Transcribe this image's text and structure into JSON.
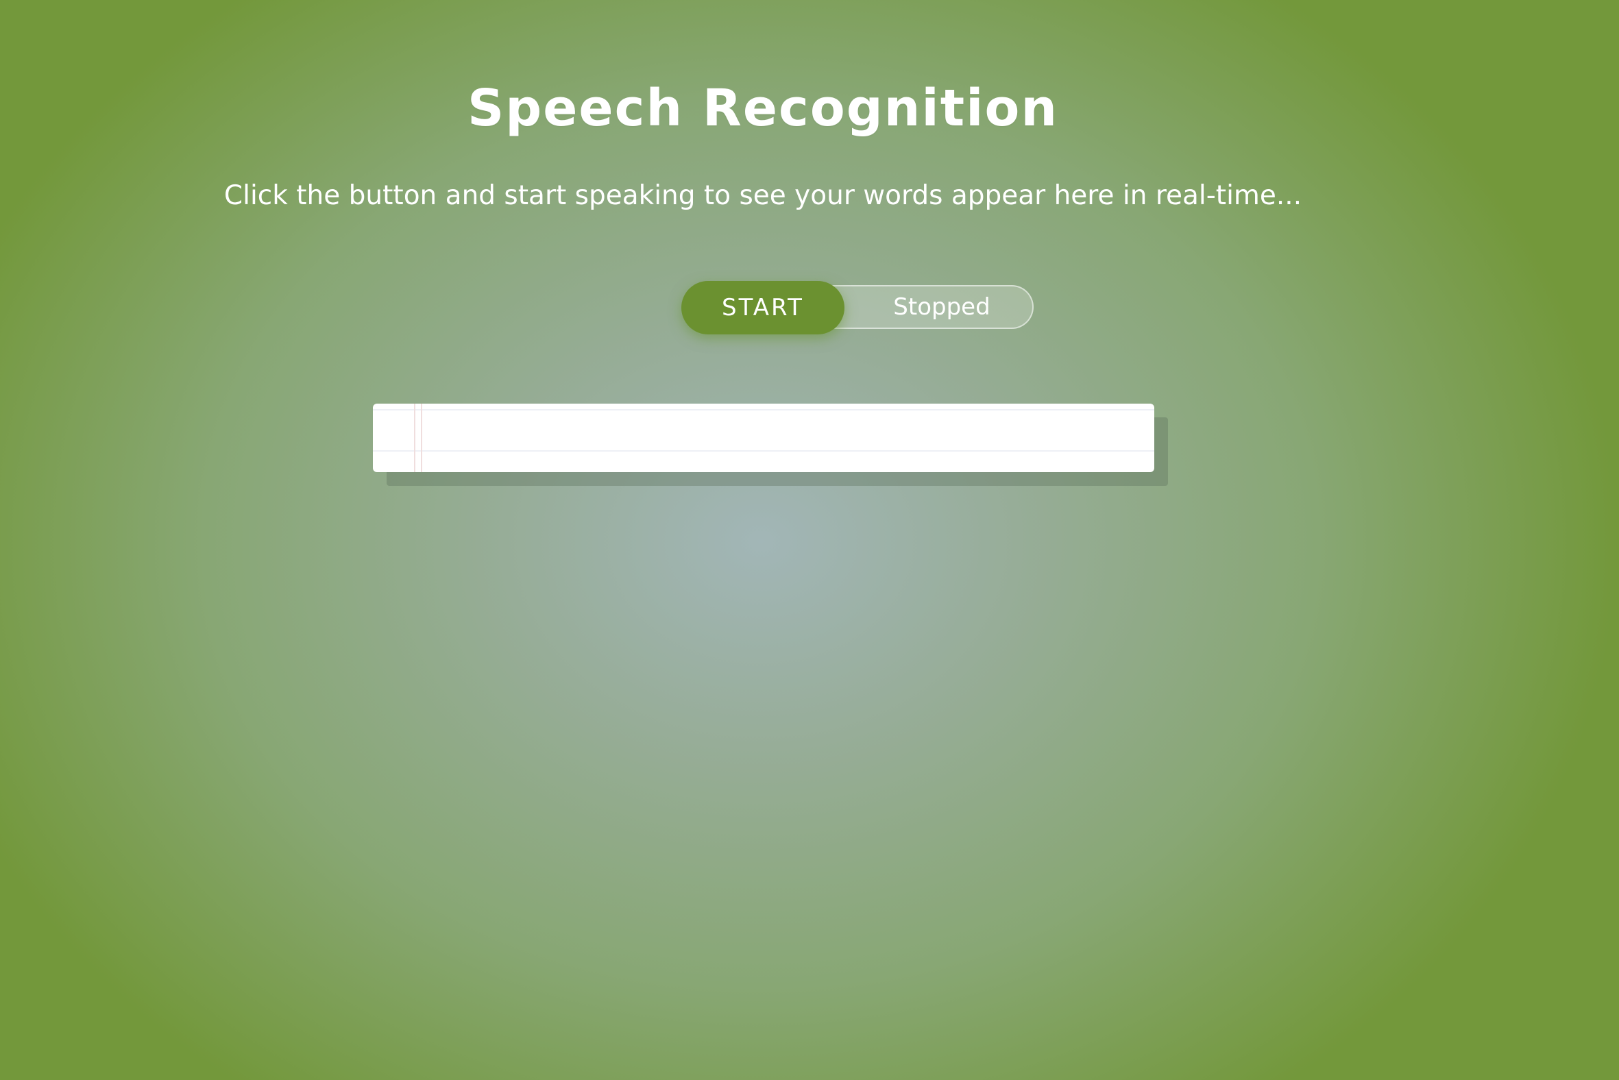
{
  "page": {
    "title": "Speech Recognition",
    "subtitle": "Click the button and start speaking to see your words appear here in real-time..."
  },
  "controls": {
    "start_label": "START",
    "status_label": "Stopped"
  },
  "transcript": {
    "text": ""
  },
  "colors": {
    "accent": "#6b9130",
    "background_edge": "#73983b",
    "background_center": "#a2b6b7",
    "paper": "#ffffff"
  }
}
